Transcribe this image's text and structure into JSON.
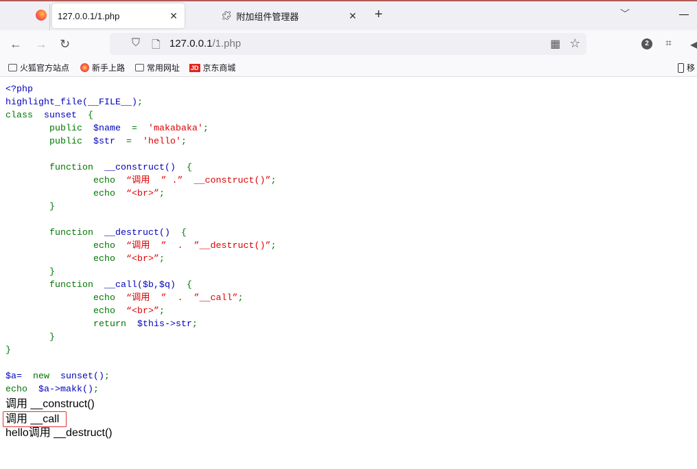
{
  "browser": {
    "tabs": [
      {
        "label": "127.0.0.1/1.php",
        "active": true
      },
      {
        "label": "附加组件管理器",
        "active": false
      }
    ],
    "url_host": "127.0.0.1",
    "url_path": "/1.php",
    "extension_badge": "2",
    "bookmarks": [
      {
        "label": "火狐官方站点",
        "icon": "folder-icon"
      },
      {
        "label": "新手上路",
        "icon": "firefox-icon"
      },
      {
        "label": "常用网址",
        "icon": "folder-icon"
      },
      {
        "label": "京东商城",
        "icon": "jd-icon"
      }
    ],
    "mobile_bookmarks": "移",
    "jd_logo": "JD"
  },
  "code_lines": [
    [
      [
        "<?php",
        "blue"
      ]
    ],
    [
      [
        "highlight_file(__FILE__)",
        "blue"
      ],
      [
        ";",
        "green"
      ]
    ],
    [
      [
        "class  ",
        "green"
      ],
      [
        "sunset  ",
        "blue"
      ],
      [
        "{",
        "green"
      ]
    ],
    [
      [
        "        public  ",
        "green"
      ],
      [
        "$name  ",
        "blue"
      ],
      [
        "=  ",
        "green"
      ],
      [
        "'makabaka'",
        "red"
      ],
      [
        ";",
        "green"
      ]
    ],
    [
      [
        "        public  ",
        "green"
      ],
      [
        "$str  ",
        "blue"
      ],
      [
        "=  ",
        "green"
      ],
      [
        "'hello'",
        "red"
      ],
      [
        ";",
        "green"
      ]
    ],
    [],
    [
      [
        "        function  ",
        "green"
      ],
      [
        "__construct()  ",
        "blue"
      ],
      [
        "{",
        "green"
      ]
    ],
    [
      [
        "                echo  ",
        "green"
      ],
      [
        "“调用  ” .”  __construct()”",
        "red"
      ],
      [
        ";",
        "green"
      ]
    ],
    [
      [
        "                echo  ",
        "green"
      ],
      [
        "“<br>”",
        "red"
      ],
      [
        ";",
        "green"
      ]
    ],
    [
      [
        "        }",
        "green"
      ]
    ],
    [],
    [
      [
        "        function  ",
        "green"
      ],
      [
        "__destruct()  ",
        "blue"
      ],
      [
        "{",
        "green"
      ]
    ],
    [
      [
        "                echo  ",
        "green"
      ],
      [
        "“调用  ”  .  ”__destruct()”",
        "red"
      ],
      [
        ";",
        "green"
      ]
    ],
    [
      [
        "                echo  ",
        "green"
      ],
      [
        "“<br>”",
        "red"
      ],
      [
        ";",
        "green"
      ]
    ],
    [
      [
        "        }",
        "green"
      ]
    ],
    [
      [
        "        function  ",
        "green"
      ],
      [
        "__call($b,$q)  ",
        "blue"
      ],
      [
        "{",
        "green"
      ]
    ],
    [
      [
        "                echo  ",
        "green"
      ],
      [
        "“调用  ”  .  ”__call”",
        "red"
      ],
      [
        ";",
        "green"
      ]
    ],
    [
      [
        "                echo  ",
        "green"
      ],
      [
        "“<br>”",
        "red"
      ],
      [
        ";",
        "green"
      ]
    ],
    [
      [
        "                return  ",
        "green"
      ],
      [
        "$this->str",
        "blue"
      ],
      [
        ";",
        "green"
      ]
    ],
    [
      [
        "        }",
        "green"
      ]
    ],
    [
      [
        "}",
        "green"
      ]
    ],
    [],
    [
      [
        "$a=  ",
        "blue"
      ],
      [
        "new  ",
        "green"
      ],
      [
        "sunset()",
        "blue"
      ],
      [
        ";",
        "green"
      ]
    ],
    [
      [
        "echo  ",
        "green"
      ],
      [
        "$a->makk()",
        "blue"
      ],
      [
        ";",
        "green"
      ]
    ]
  ],
  "output": [
    "调用  __construct()",
    "调用 __call",
    "hello调用 __destruct()"
  ],
  "colors": {
    "keyword": "#007700",
    "default": "#0000bb",
    "string": "#dd0000",
    "highlight_box": "#e03030"
  }
}
